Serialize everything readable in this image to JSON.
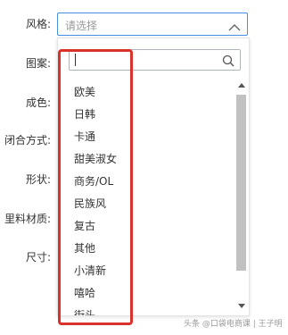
{
  "form": {
    "labels": {
      "style": "风格:",
      "pattern": "图案:",
      "color": "成色:",
      "closure": "闭合方式:",
      "shape": "形状:",
      "lining": "里料材质:",
      "size": "尺寸:"
    },
    "style_select": {
      "placeholder": "请选择",
      "expanded": true
    }
  },
  "dropdown": {
    "search_value": "",
    "options": [
      "欧美",
      "日韩",
      "卡通",
      "甜美淑女",
      "商务/OL",
      "民族风",
      "复古",
      "其他",
      "小清新",
      "嘻哈",
      "街头"
    ]
  },
  "icons": {
    "chevron": "chevron-up-icon",
    "search": "search-icon"
  },
  "colors": {
    "accent_border": "#4a90e2",
    "highlight": "#d9322c"
  },
  "watermark": "头条 @口袋电商课 | 王子明"
}
